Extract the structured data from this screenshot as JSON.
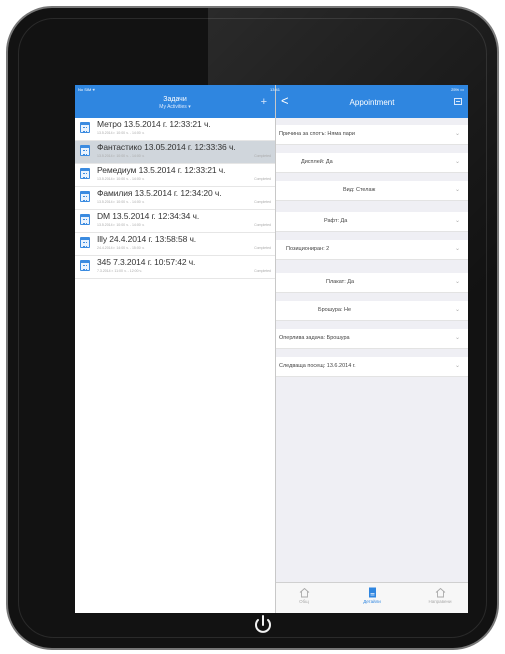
{
  "left_panel": {
    "status_left": "No SIM ⚹",
    "title": "Задачи",
    "subtitle": "My Activities ▾",
    "add_label": "+",
    "tasks": [
      {
        "title": "Метро    13.5.2014 г. 12:33:21 ч.",
        "time": "13.5.2014 г. 10:00 ч. - 14:00 ч.",
        "status": "",
        "selected": false
      },
      {
        "title": "Фантастико  13.05.2014 г.  12:33:36 ч.",
        "time": "13.5.2014 г. 10:00 ч. - 14:00 ч.",
        "status": "Completed",
        "selected": true
      },
      {
        "title": "Ремедиум   13.5.2014 г. 12:33:21 ч.",
        "time": "13.5.2014 г. 10:00 ч. - 14:00 ч.",
        "status": "Completed",
        "selected": false
      },
      {
        "title": "Фамилия 13.5.2014 г. 12:34:20 ч.",
        "time": "13.5.2014 г. 10:00 ч. - 14:00 ч.",
        "status": "Completed",
        "selected": false
      },
      {
        "title": "DM      13.5.2014 г. 12:34:34 ч.",
        "time": "13.5.2014 г. 10:00 ч. - 14:00 ч.",
        "status": "Completed",
        "selected": false
      },
      {
        "title": "Illy      24.4.2014 г. 13:58:58 ч.",
        "time": "24.4.2014 г. 14:00 ч. - 15:00 ч.",
        "status": "Completed",
        "selected": false
      },
      {
        "title": "345      7.3.2014 г. 10:57:42 ч.",
        "time": "7.3.2014 г. 11:00 ч. - 12:00 ч.",
        "status": "Completed",
        "selected": false
      }
    ]
  },
  "right_panel": {
    "status_time": "13:41",
    "status_battery": "25% ▭",
    "back_label": "<",
    "title": "Appointment",
    "fields": [
      "Причина за спотъ: Няма пари",
      "Дисплей: Да",
      "Вид: Стелаж",
      "Рафт: Да",
      "Позициониран: 2",
      "Плакат: Да",
      "Брошура: Не",
      "Оперлива задача: Брошура",
      "Следваща посещ: 13.6.2014 г."
    ]
  },
  "tabbar": {
    "tabs": [
      {
        "label": "Общ",
        "icon": "home-icon",
        "active": false
      },
      {
        "label": "Детайли",
        "icon": "document-icon",
        "active": true
      },
      {
        "label": "Направени",
        "icon": "home-icon",
        "active": false
      }
    ]
  },
  "colors": {
    "accent": "#2f86e0",
    "frame": "#121212"
  }
}
